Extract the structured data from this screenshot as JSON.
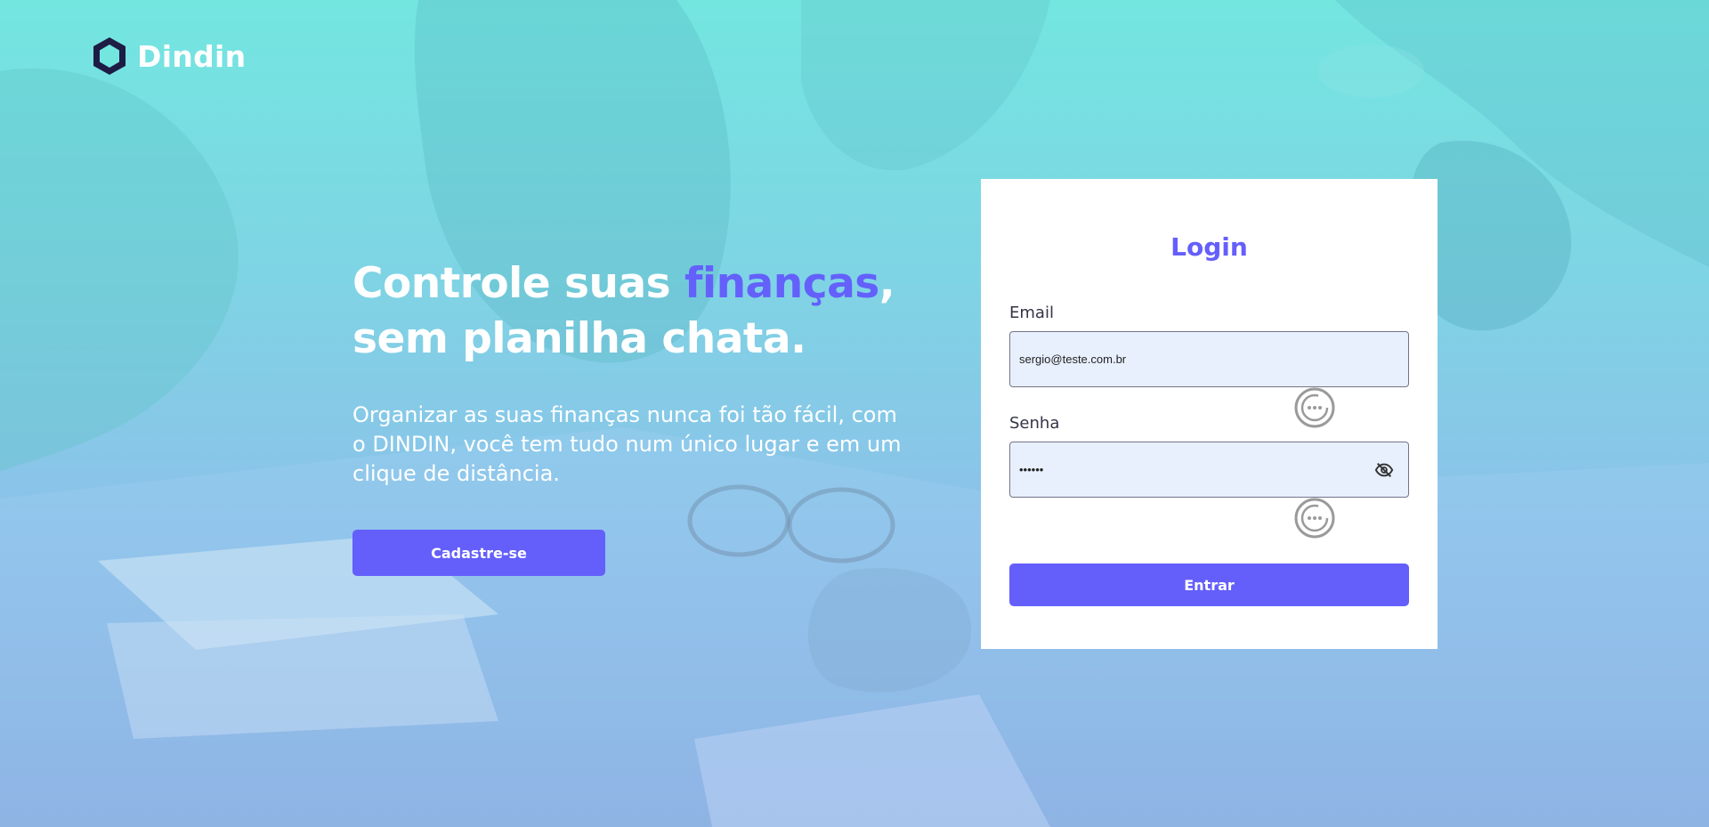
{
  "brand": {
    "name": "Dindin",
    "logo_icon": "hexagon-logo-icon",
    "colors": {
      "accent": "#645ffb",
      "logo_dark": "#1d1c45",
      "logo_fill": "#73e6e0",
      "white": "#ffffff"
    }
  },
  "hero": {
    "title_part1": "Controle suas ",
    "title_accent": "finanças",
    "title_part2": ",",
    "title_line2": "sem planilha chata.",
    "subtitle": "Organizar as suas finanças nunca foi tão fácil, com o DINDIN, você tem tudo num único lugar e em um clique de distância.",
    "signup_label": "Cadastre-se"
  },
  "login": {
    "title": "Login",
    "email_label": "Email",
    "email_value": "sergio@teste.com.br",
    "password_label": "Senha",
    "password_value": "••••••",
    "toggle_icon": "eye-off-icon",
    "helper_icon": "password-manager-icon",
    "submit_label": "Entrar"
  }
}
